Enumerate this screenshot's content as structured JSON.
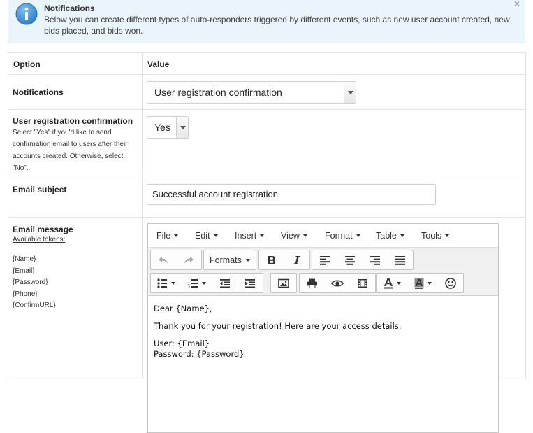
{
  "alert": {
    "title": "Notifications",
    "text": "Below you can create different types of auto-responders triggered by different events, such as new user account created, new bids placed, and bids won.",
    "close": "×"
  },
  "table": {
    "headers": [
      "Option",
      "Value"
    ],
    "notifications": {
      "label": "Notifications",
      "value": "User registration confirmation"
    },
    "confirmation": {
      "label": "User registration confirmation",
      "help": "Select \"Yes\" if you'd like to send confirmation email to users after their accounts created. Otherwise, select \"No\".",
      "value": "Yes"
    },
    "subject": {
      "label": "Email subject",
      "value": "Successful account registration"
    },
    "message": {
      "label": "Email message",
      "tokens_label": "Available tokens:",
      "tokens": [
        "{Name}",
        "{Email}",
        "{Password}",
        "{Phone}",
        "{ConfirmURL}"
      ]
    }
  },
  "editor": {
    "menu": [
      "File",
      "Edit",
      "Insert",
      "View",
      "Format",
      "Table",
      "Tools"
    ],
    "formats_label": "Formats",
    "content": {
      "greeting": "Dear {Name},",
      "line1": "Thank you for your registration! Here are your access details:",
      "user_line": "User: {Email}",
      "password_line": "Password: {Password}"
    }
  },
  "colors": {
    "alert_bg": "#e9f4fb",
    "info_icon": "#3d8fd6",
    "border": "#e2e2e2"
  }
}
